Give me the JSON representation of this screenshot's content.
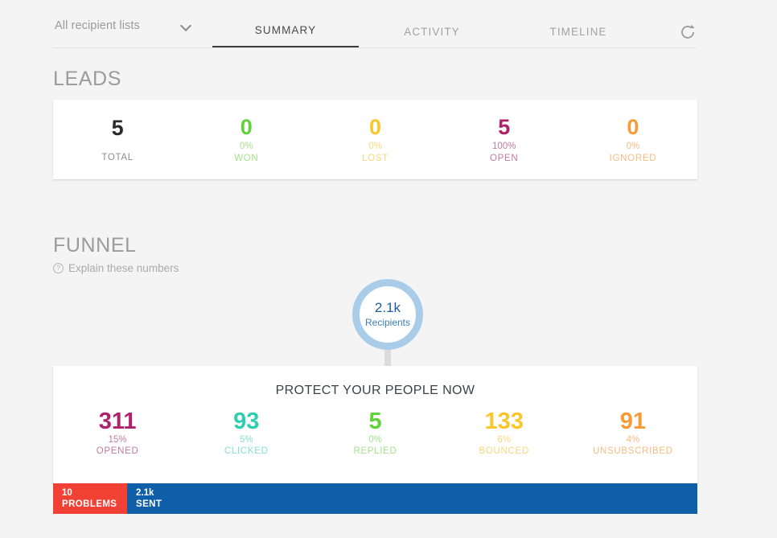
{
  "topbar": {
    "recipient_select": {
      "value": "All recipient lists",
      "icon": "chevron-down-icon"
    },
    "tabs": [
      {
        "label": "SUMMARY",
        "active": true
      },
      {
        "label": "ACTIVITY",
        "active": false
      },
      {
        "label": "TIMELINE",
        "active": false
      }
    ],
    "refresh_icon": "refresh-icon"
  },
  "leads": {
    "title": "LEADS",
    "stats": [
      {
        "num": "5",
        "pct": "",
        "cap": "TOTAL",
        "color": "#2b2b2b",
        "sub": "#8d8d8d"
      },
      {
        "num": "0",
        "pct": "0%",
        "cap": "WON",
        "color": "#5fd43a",
        "sub": "#a5e28c"
      },
      {
        "num": "0",
        "pct": "0%",
        "cap": "LOST",
        "color": "#fcc62a",
        "sub": "#f7d77f"
      },
      {
        "num": "5",
        "pct": "100%",
        "cap": "OPEN",
        "color": "#b0216b",
        "sub": "#c27ba0"
      },
      {
        "num": "0",
        "pct": "0%",
        "cap": "IGNORED",
        "color": "#f79a37",
        "sub": "#f5bd84"
      }
    ]
  },
  "funnel": {
    "title": "FUNNEL",
    "explain": {
      "label": "Explain these numbers",
      "icon": "help-circle-icon"
    },
    "bubble": {
      "value": "2.1k",
      "label": "Recipients",
      "ring_color": "#a9cde8"
    },
    "card_title": "PROTECT YOUR PEOPLE NOW",
    "stats": [
      {
        "num": "311",
        "pct": "15%",
        "cap": "OPENED",
        "color": "#b0216b",
        "sub": "#c27ba0"
      },
      {
        "num": "93",
        "pct": "5%",
        "cap": "CLICKED",
        "color": "#2ecfb0",
        "sub": "#86e0d0"
      },
      {
        "num": "5",
        "pct": "0%",
        "cap": "REPLIED",
        "color": "#5fd43a",
        "sub": "#a5e28c"
      },
      {
        "num": "133",
        "pct": "6%",
        "cap": "BOUNCED",
        "color": "#fcc62a",
        "sub": "#f7d77f"
      },
      {
        "num": "91",
        "pct": "4%",
        "cap": "UNSUBSCRIBED",
        "color": "#f79a37",
        "sub": "#f5bd84"
      }
    ],
    "bar": {
      "problems": {
        "value": "10",
        "label": "PROBLEMS",
        "color": "#f04134"
      },
      "sent": {
        "value": "2.1k",
        "label": "SENT",
        "color": "#0f5fa8"
      }
    }
  },
  "chart_data": {
    "type": "bar",
    "title": "PROTECT YOUR PEOPLE NOW",
    "categories": [
      "OPENED",
      "CLICKED",
      "REPLIED",
      "BOUNCED",
      "UNSUBSCRIBED"
    ],
    "values": [
      311,
      93,
      5,
      133,
      91
    ],
    "percentages": [
      15,
      5,
      0,
      6,
      4
    ],
    "total_recipients": 2100,
    "sent": 2100,
    "problems": 10,
    "leads": {
      "categories": [
        "TOTAL",
        "WON",
        "LOST",
        "OPEN",
        "IGNORED"
      ],
      "values": [
        5,
        0,
        0,
        5,
        0
      ],
      "percentages": [
        null,
        0,
        0,
        100,
        0
      ]
    }
  }
}
